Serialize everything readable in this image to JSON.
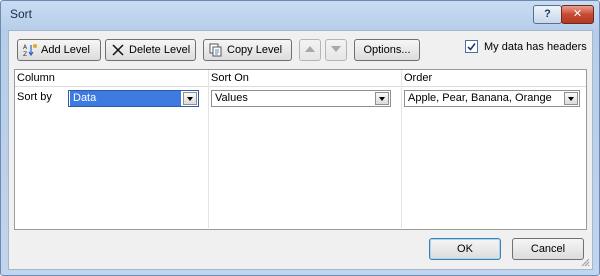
{
  "window": {
    "title": "Sort"
  },
  "titlebar": {
    "help_glyph": "?",
    "close_glyph": "✕"
  },
  "toolbar": {
    "add_level": "Add Level",
    "delete_level": "Delete Level",
    "copy_level": "Copy Level",
    "options": "Options...",
    "headers_checkbox_label": "My data has headers",
    "headers_checked": true
  },
  "grid": {
    "headers": {
      "column": "Column",
      "sort_on": "Sort On",
      "order": "Order"
    },
    "rows": [
      {
        "label": "Sort by",
        "column": "Data",
        "sort_on": "Values",
        "order": "Apple, Pear, Banana, Orange"
      }
    ]
  },
  "footer": {
    "ok": "OK",
    "cancel": "Cancel"
  },
  "colors": {
    "title_bar": "#c9dcf3",
    "close_red": "#c84a33",
    "selection_blue": "#3d7be0"
  }
}
